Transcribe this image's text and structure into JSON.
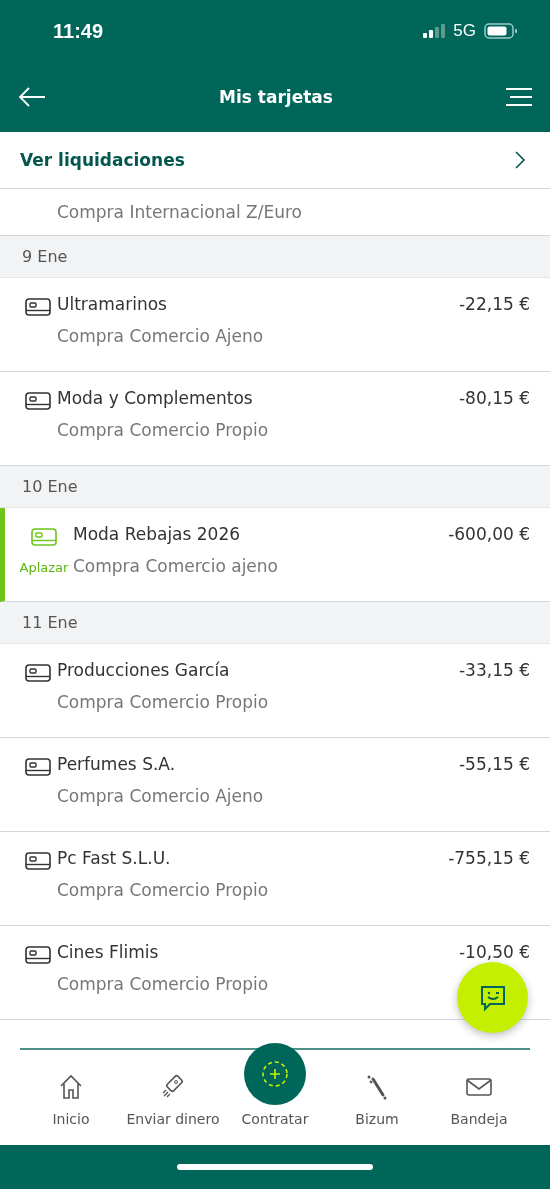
{
  "status_bar": {
    "time": "11:49",
    "network": "5G"
  },
  "header": {
    "title": "Mis tarjetas"
  },
  "settlements_link": {
    "label": "Ver liquidaciones"
  },
  "partial_row": {
    "subtitle": "Compra Internacional Z/Euro"
  },
  "groups": [
    {
      "date": "9 Ene",
      "rows": [
        {
          "title": "Ultramarinos",
          "subtitle": "Compra Comercio Ajeno",
          "amount": "-22,15 €",
          "highlighted": false
        },
        {
          "title": "Moda y Complementos",
          "subtitle": "Compra Comercio Propio",
          "amount": "-80,15 €",
          "highlighted": false
        }
      ]
    },
    {
      "date": "10 Ene",
      "rows": [
        {
          "title": "Moda Rebajas 2026",
          "subtitle": "Compra Comercio ajeno",
          "amount": "-600,00 €",
          "highlighted": true,
          "action": "Aplazar"
        }
      ]
    },
    {
      "date": "11 Ene",
      "rows": [
        {
          "title": "Producciones García",
          "subtitle": "Compra Comercio Propio",
          "amount": "-33,15 €",
          "highlighted": false
        },
        {
          "title": "Perfumes S.A.",
          "subtitle": "Compra Comercio Ajeno",
          "amount": "-55,15 €",
          "highlighted": false
        },
        {
          "title": "Pc Fast S.L.U.",
          "subtitle": "Compra Comercio Propio",
          "amount": "-755,15 €",
          "highlighted": false
        },
        {
          "title": "Cines Flimis",
          "subtitle": "Compra Comercio Propio",
          "amount": "-10,50 €",
          "highlighted": false
        }
      ]
    }
  ],
  "nav": [
    {
      "kind": "home",
      "label": "Inicio"
    },
    {
      "kind": "send",
      "label": "Enviar dinero"
    },
    {
      "kind": "hire",
      "label": "Contratar"
    },
    {
      "kind": "bizum",
      "label": "Bizum"
    },
    {
      "kind": "inbox",
      "label": "Bandeja"
    }
  ]
}
